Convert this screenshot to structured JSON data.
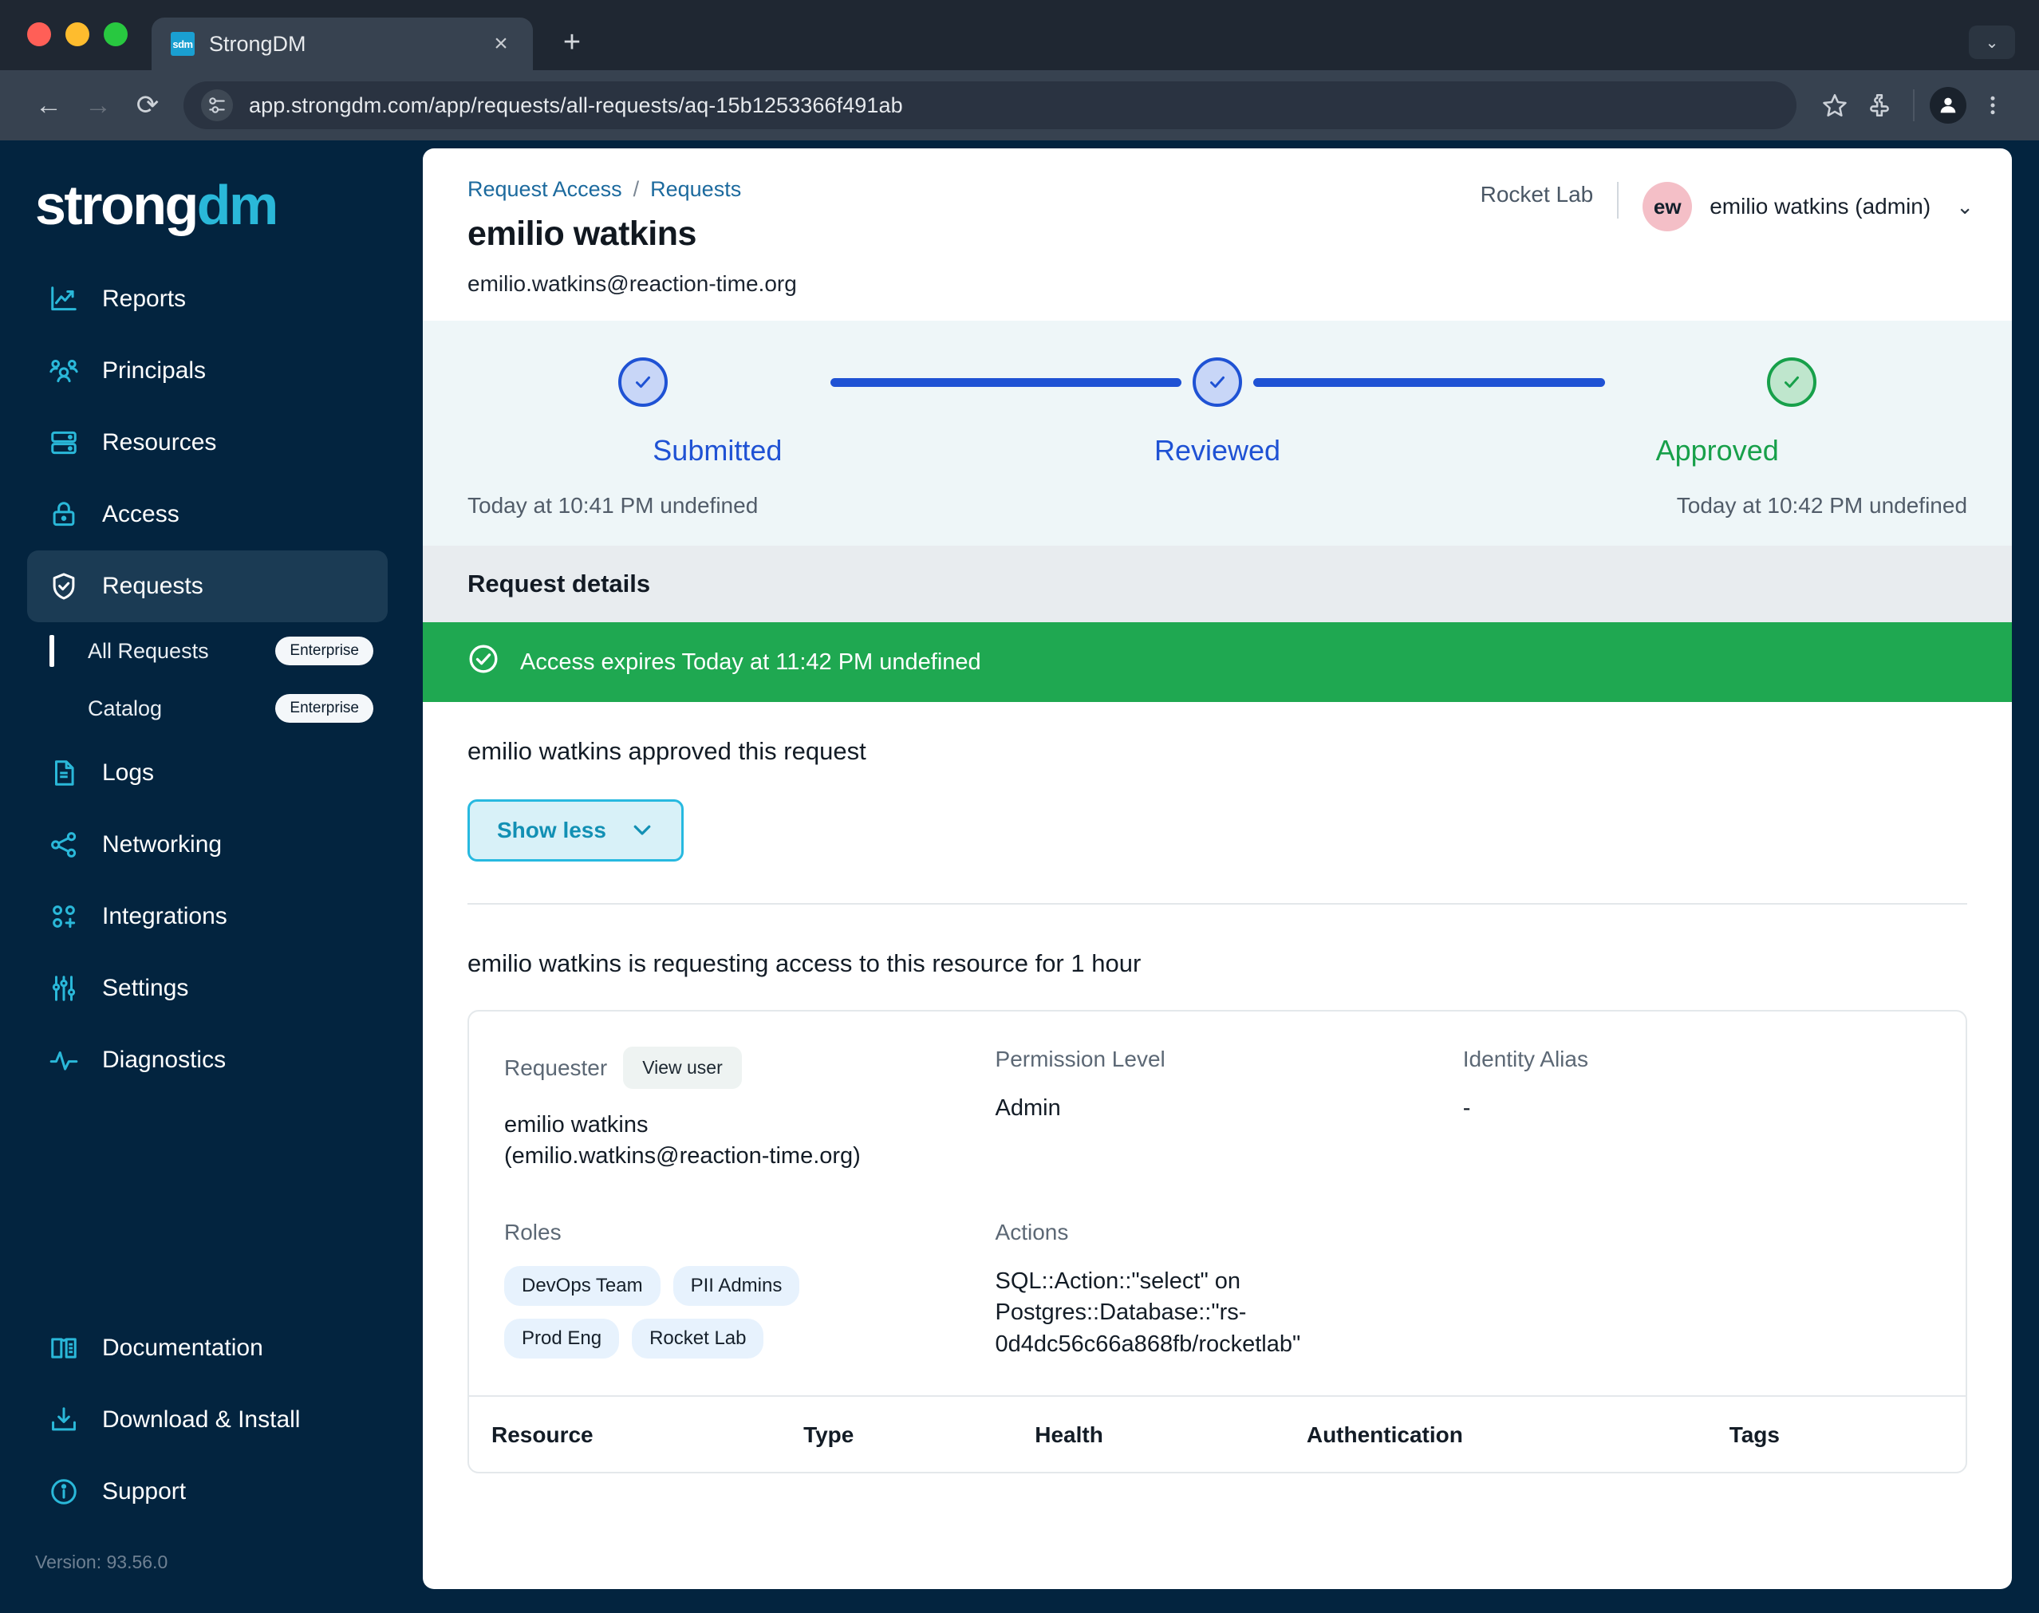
{
  "browser": {
    "tab": {
      "title": "StrongDM",
      "favicon_text": "sdm",
      "favicon_name": "strongdm-favicon"
    },
    "new_tab_label": "+",
    "close_label": "×",
    "tabstrip_menu_label": "⌄",
    "url": "app.strongdm.com/app/requests/all-requests/aq-15b1253366f491ab",
    "back_label": "←",
    "forward_label": "→",
    "reload_label": "⟳"
  },
  "sidebar": {
    "logo": {
      "part1": "strong",
      "part2": "dm"
    },
    "items": [
      {
        "label": "Reports",
        "icon": "chart-line-icon"
      },
      {
        "label": "Principals",
        "icon": "users-icon"
      },
      {
        "label": "Resources",
        "icon": "server-icon"
      },
      {
        "label": "Access",
        "icon": "lock-icon"
      },
      {
        "label": "Requests",
        "icon": "shield-check-icon"
      }
    ],
    "sub_items": [
      {
        "label": "All Requests",
        "badge": "Enterprise",
        "active": true
      },
      {
        "label": "Catalog",
        "badge": "Enterprise",
        "active": false
      }
    ],
    "items2": [
      {
        "label": "Logs",
        "icon": "document-icon"
      },
      {
        "label": "Networking",
        "icon": "share-nodes-icon"
      },
      {
        "label": "Integrations",
        "icon": "integrations-icon"
      },
      {
        "label": "Settings",
        "icon": "sliders-icon"
      },
      {
        "label": "Diagnostics",
        "icon": "pulse-icon"
      }
    ],
    "bottom_items": [
      {
        "label": "Documentation",
        "icon": "book-icon"
      },
      {
        "label": "Download & Install",
        "icon": "download-icon"
      },
      {
        "label": "Support",
        "icon": "info-circle-icon"
      }
    ],
    "version": "Version: 93.56.0"
  },
  "header": {
    "breadcrumb": {
      "parent": "Request Access",
      "separator": "/",
      "current": "Requests"
    },
    "title": "emilio watkins",
    "email": "emilio.watkins@reaction-time.org",
    "org": "Rocket Lab",
    "avatar_initials": "ew",
    "user_label": "emilio watkins (admin)",
    "caret": "⌄"
  },
  "stepper": {
    "steps": [
      {
        "label": "Submitted",
        "state": "blue",
        "time": "Today at 10:41 PM undefined"
      },
      {
        "label": "Reviewed",
        "state": "blue",
        "time": ""
      },
      {
        "label": "Approved",
        "state": "green",
        "time": "Today at 10:42 PM undefined"
      }
    ]
  },
  "details": {
    "header": "Request details",
    "expiry_banner": "Access expires Today at 11:42 PM undefined",
    "approved_line": "emilio watkins approved this request",
    "show_less_label": "Show less",
    "show_less_caret": "⌄",
    "request_line": "emilio watkins is requesting access to this resource for 1 hour",
    "fields": {
      "requester_label": "Requester",
      "view_user_label": "View user",
      "requester_value": "emilio watkins (emilio.watkins@reaction-time.org)",
      "permission_label": "Permission Level",
      "permission_value": "Admin",
      "identity_alias_label": "Identity Alias",
      "identity_alias_value": "-",
      "roles_label": "Roles",
      "roles": [
        "DevOps Team",
        "PII Admins",
        "Prod Eng",
        "Rocket Lab"
      ],
      "actions_label": "Actions",
      "actions_value": "SQL::Action::\"select\" on Postgres::Database::\"rs-0d4dc56c66a868fb/rocketlab\""
    },
    "table_headers": [
      "Resource",
      "Type",
      "Health",
      "Authentication",
      "Tags"
    ]
  },
  "colors": {
    "sidebar_bg": "#03243f",
    "accent_teal": "#2ab8d9",
    "step_blue": "#1f52d4",
    "success_green": "#1fa851",
    "avatar_pink": "#f4bfc7"
  }
}
